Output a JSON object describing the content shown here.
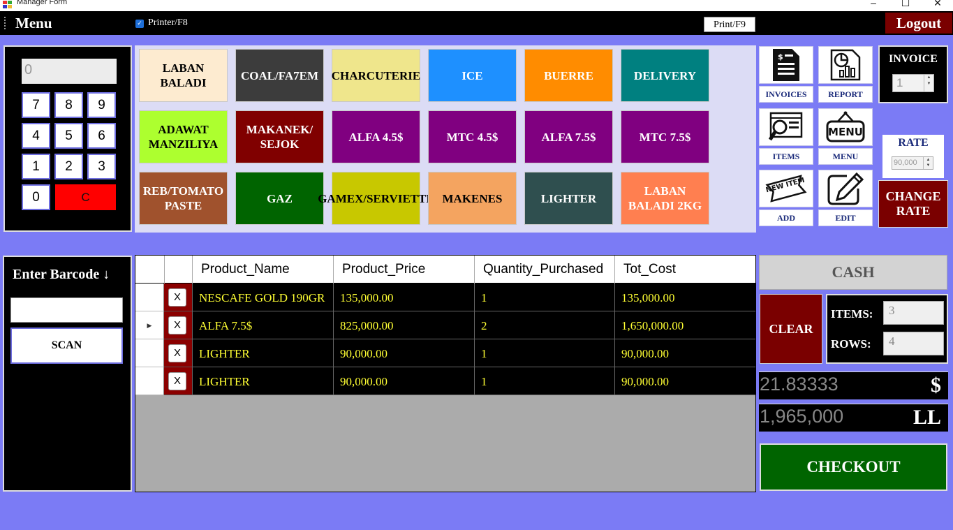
{
  "window": {
    "title": "Manager Form",
    "controls": [
      "–",
      "☐",
      "✕"
    ]
  },
  "menubar": {
    "menu_label": "Menu",
    "printer_checkbox_label": "Printer/F8",
    "printer_checked": true,
    "print_button": "Print/F9",
    "logout_button": "Logout"
  },
  "keypad": {
    "display_value": "0",
    "keys": [
      "7",
      "8",
      "9",
      "4",
      "5",
      "6",
      "1",
      "2",
      "3",
      "0"
    ],
    "clear_key": "C"
  },
  "categories": [
    {
      "label": "LABAN BALADI",
      "bg": "#fdebd0",
      "fg": "#000000"
    },
    {
      "label": "COAL/FA7EM",
      "bg": "#3c3c3c",
      "fg": "#ffffff"
    },
    {
      "label": "CHARCUTERIE",
      "bg": "#efe68c",
      "fg": "#000000"
    },
    {
      "label": "ICE",
      "bg": "#1e90ff",
      "fg": "#ffffff"
    },
    {
      "label": "BUERRE",
      "bg": "#ff8c00",
      "fg": "#ffffff"
    },
    {
      "label": "DELIVERY",
      "bg": "#008080",
      "fg": "#ffffff"
    },
    {
      "label": "ADAWAT MANZILIYA",
      "bg": "#adff2f",
      "fg": "#000000"
    },
    {
      "label": "MAKANEK/ SEJOK",
      "bg": "#800000",
      "fg": "#ffffff"
    },
    {
      "label": "ALFA 4.5$",
      "bg": "#800080",
      "fg": "#ffffff"
    },
    {
      "label": "MTC 4.5$",
      "bg": "#800080",
      "fg": "#ffffff"
    },
    {
      "label": "ALFA 7.5$",
      "bg": "#800080",
      "fg": "#ffffff"
    },
    {
      "label": "MTC 7.5$",
      "bg": "#800080",
      "fg": "#ffffff"
    },
    {
      "label": "REB/TOMATO PASTE",
      "bg": "#a0522d",
      "fg": "#ffffff"
    },
    {
      "label": "GAZ",
      "bg": "#006400",
      "fg": "#ffffff"
    },
    {
      "label": "GAMEX/SERVIETTE",
      "bg": "#c8c800",
      "fg": "#000000"
    },
    {
      "label": "MAKENES",
      "bg": "#f4a460",
      "fg": "#000000"
    },
    {
      "label": "LIGHTER",
      "bg": "#2f4f4f",
      "fg": "#ffffff"
    },
    {
      "label": "LABAN BALADI 2KG",
      "bg": "#ff7f50",
      "fg": "#ffffff"
    }
  ],
  "tools": {
    "invoices": "INVOICES",
    "report": "REPORT",
    "items": "ITEMS",
    "menu": "MENU",
    "add": "ADD",
    "edit": "EDIT",
    "new_item_text": "NEW ITEM",
    "menu_icon_text": "MENU"
  },
  "invoice": {
    "label": "INVOICE",
    "value": "1"
  },
  "rate": {
    "label": "RATE",
    "value": "90,000"
  },
  "change_rate_button": "CHANGE RATE",
  "barcode": {
    "label": "Enter Barcode ↓",
    "value": "",
    "scan_button": "SCAN"
  },
  "table": {
    "columns": [
      "Product_Name",
      "Product_Price",
      "Quantity_Purchased",
      "Tot_Cost"
    ],
    "remove_label": "X",
    "rows": [
      {
        "marker": "",
        "name": "NESCAFE GOLD 190GR",
        "price": "135,000.00",
        "qty": "1",
        "total": "135,000.00"
      },
      {
        "marker": "▶",
        "name": "ALFA 7.5$",
        "price": "825,000.00",
        "qty": "2",
        "total": "1,650,000.00"
      },
      {
        "marker": "",
        "name": "LIGHTER",
        "price": "90,000.00",
        "qty": "1",
        "total": "90,000.00"
      },
      {
        "marker": "",
        "name": "LIGHTER",
        "price": "90,000.00",
        "qty": "1",
        "total": "90,000.00"
      }
    ]
  },
  "summary": {
    "cash_button": "CASH",
    "clear_button": "CLEAR",
    "items_label": "ITEMS:",
    "items_value": "3",
    "rows_label": "ROWS:",
    "rows_value": "4",
    "usd_total": "21.83333",
    "usd_symbol": "$",
    "lbp_total": "1,965,000",
    "lbp_symbol": "LL",
    "checkout_button": "CHECKOUT"
  }
}
